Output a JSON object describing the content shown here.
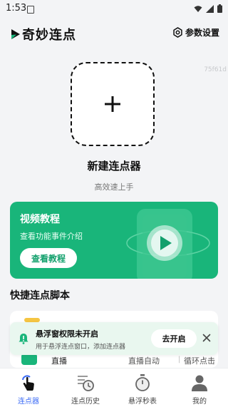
{
  "status_bar": {
    "time": "1:53"
  },
  "header": {
    "app_title": "奇妙连点",
    "settings_label": "参数设置",
    "hash_text": "75f61d"
  },
  "create": {
    "title": "新建连点器",
    "subtitle": "高效速上手"
  },
  "video_card": {
    "title": "视频教程",
    "description": "查看功能事件介绍",
    "button_label": "查看教程"
  },
  "quick_scripts": {
    "title": "快捷连点脚本",
    "items": [
      {
        "name": "直播",
        "mode": "直播自动",
        "loop": "循环点击"
      }
    ]
  },
  "toast": {
    "title": "悬浮窗权限未开启",
    "description": "用于悬浮连点窗口，添加连点器",
    "button_label": "去开启"
  },
  "bottom_nav": {
    "items": [
      {
        "label": "连点器",
        "active": true
      },
      {
        "label": "连点历史",
        "active": false
      },
      {
        "label": "悬浮秒表",
        "active": false
      },
      {
        "label": "我的",
        "active": false
      }
    ]
  },
  "colors": {
    "brand_green": "#19b57a",
    "active_blue": "#3d6cf5",
    "toast_bg": "#e9f7ef"
  }
}
